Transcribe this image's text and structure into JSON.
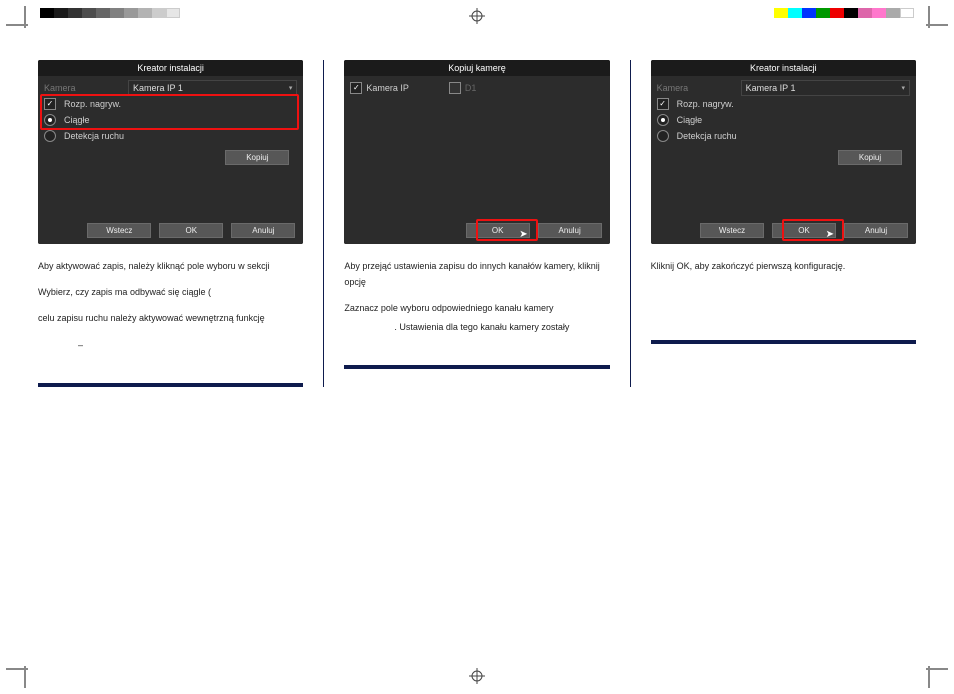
{
  "registration": {
    "gray": [
      "#000",
      "#111",
      "#222",
      "#333",
      "#555",
      "#777",
      "#999",
      "#bbb",
      "#ddd",
      "#fff"
    ],
    "color": [
      "#ff0",
      "#0ff",
      "#00f",
      "#0a0",
      "#e00",
      "#000",
      "#e6a",
      "#f6d",
      "#aaa",
      "#fff"
    ]
  },
  "panels": {
    "left": {
      "title": "Kreator instalacji",
      "cameraLabel": "Kamera",
      "cameraValue": "Kamera IP 1",
      "startRec": "Rozp. nagryw.",
      "continuous": "Ciągłe",
      "motion": "Detekcja ruchu",
      "copyBtn": "Kopiuj",
      "backBtn": "Wstecz",
      "okBtn": "OK",
      "cancelBtn": "Anuluj",
      "desc1": "Aby aktywować zapis, należy kliknąć pole wyboru w sekcji",
      "desc2": "Wybierz, czy zapis ma odbywać się ciągle (",
      "desc3": "celu zapisu ruchu należy aktywować wewnętrzną funkcję",
      "dash": "–"
    },
    "middle": {
      "title": "Kopiuj kamerę",
      "cameraIP": "Kamera IP",
      "d1": "D1",
      "okBtn": "OK",
      "cancelBtn": "Anuluj",
      "desc1": "Aby przejąć ustawienia zapisu do innych kanałów kamery, kliknij opcję",
      "desc2": "Zaznacz pole wyboru odpowiedniego kanału kamery",
      "desc3": ". Ustawienia dla tego kanału kamery zostały"
    },
    "right": {
      "title": "Kreator instalacji",
      "cameraLabel": "Kamera",
      "cameraValue": "Kamera IP 1",
      "startRec": "Rozp. nagryw.",
      "continuous": "Ciągłe",
      "motion": "Detekcja ruchu",
      "copyBtn": "Kopiuj",
      "backBtn": "Wstecz",
      "okBtn": "OK",
      "cancelBtn": "Anuluj",
      "desc1": "Kliknij OK, aby zakończyć pierwszą konfigurację."
    }
  }
}
